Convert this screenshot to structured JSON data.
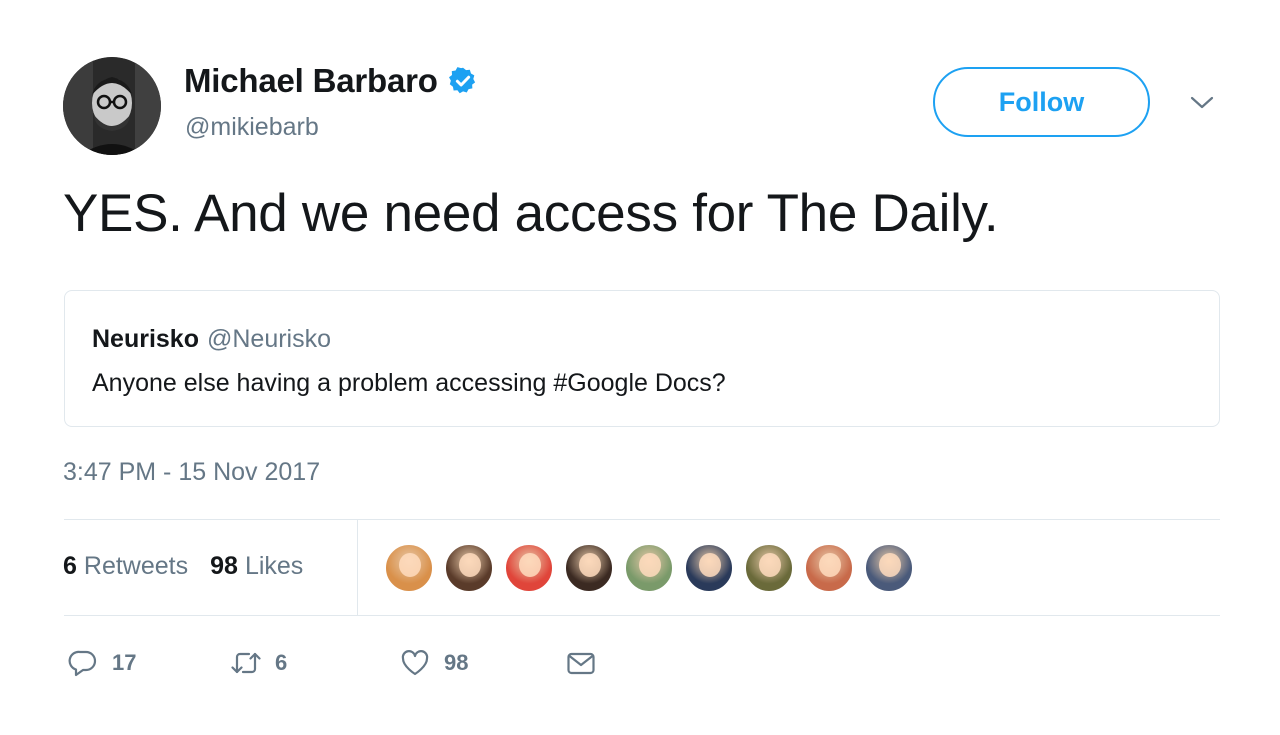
{
  "author": {
    "name": "Michael Barbaro",
    "handle": "@mikiebarb",
    "verified": true
  },
  "follow_button_label": "Follow",
  "tweet_text": "YES. And we need access for The Daily.",
  "quoted_tweet": {
    "name": "Neurisko",
    "handle": "@Neurisko",
    "text": "Anyone else having a problem accessing #Google Docs?"
  },
  "timestamp": "3:47 PM - 15 Nov 2017",
  "stats": {
    "retweets_count": "6",
    "retweets_label": "Retweets",
    "likes_count": "98",
    "likes_label": "Likes"
  },
  "likers": [
    {
      "color": "#d9904a"
    },
    {
      "color": "#5a3b2a"
    },
    {
      "color": "#e0453a"
    },
    {
      "color": "#3b2a22"
    },
    {
      "color": "#7a9a6a"
    },
    {
      "color": "#2a3a5a"
    },
    {
      "color": "#6a6a3a"
    },
    {
      "color": "#c86a4a"
    },
    {
      "color": "#4a5a7a"
    }
  ],
  "actions": {
    "reply_count": "17",
    "retweet_count": "6",
    "like_count": "98"
  },
  "colors": {
    "accent": "#1da1f2",
    "text": "#14171a",
    "muted": "#657786",
    "border": "#e1e8ed"
  },
  "icons": [
    "verified-icon",
    "caret-down-icon",
    "reply-icon",
    "retweet-icon",
    "heart-icon",
    "mail-icon"
  ]
}
